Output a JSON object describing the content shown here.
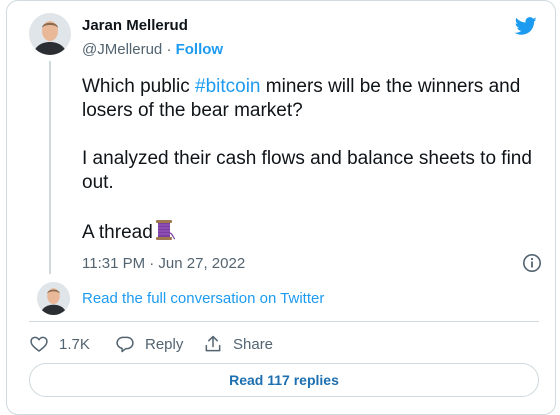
{
  "author": {
    "name": "Jaran Mellerud",
    "handle": "@JMellerud",
    "separator": "·",
    "follow_label": "Follow"
  },
  "tweet": {
    "line1_before": "Which public ",
    "hashtag": "#bitcoin",
    "line1_after": " miners will be the winners and losers of the bear market?",
    "paragraph2": "I analyzed their cash flows and balance sheets to find out.",
    "paragraph3": "A thread"
  },
  "timestamp": "11:31 PM · Jun 27, 2022",
  "read_conversation_label": "Read the full conversation on Twitter",
  "actions": {
    "like_count": "1.7K",
    "reply_label": "Reply",
    "share_label": "Share"
  },
  "read_replies_label": "Read 117 replies",
  "colors": {
    "accent": "#1d9bf0",
    "text": "#0f1419",
    "muted": "#536471",
    "border": "#cfd9de",
    "spool": "#7b3fa0"
  },
  "icons": [
    "twitter-bird-icon",
    "thread-spool-emoji",
    "info-icon",
    "heart-icon",
    "reply-bubble-icon",
    "share-icon"
  ]
}
